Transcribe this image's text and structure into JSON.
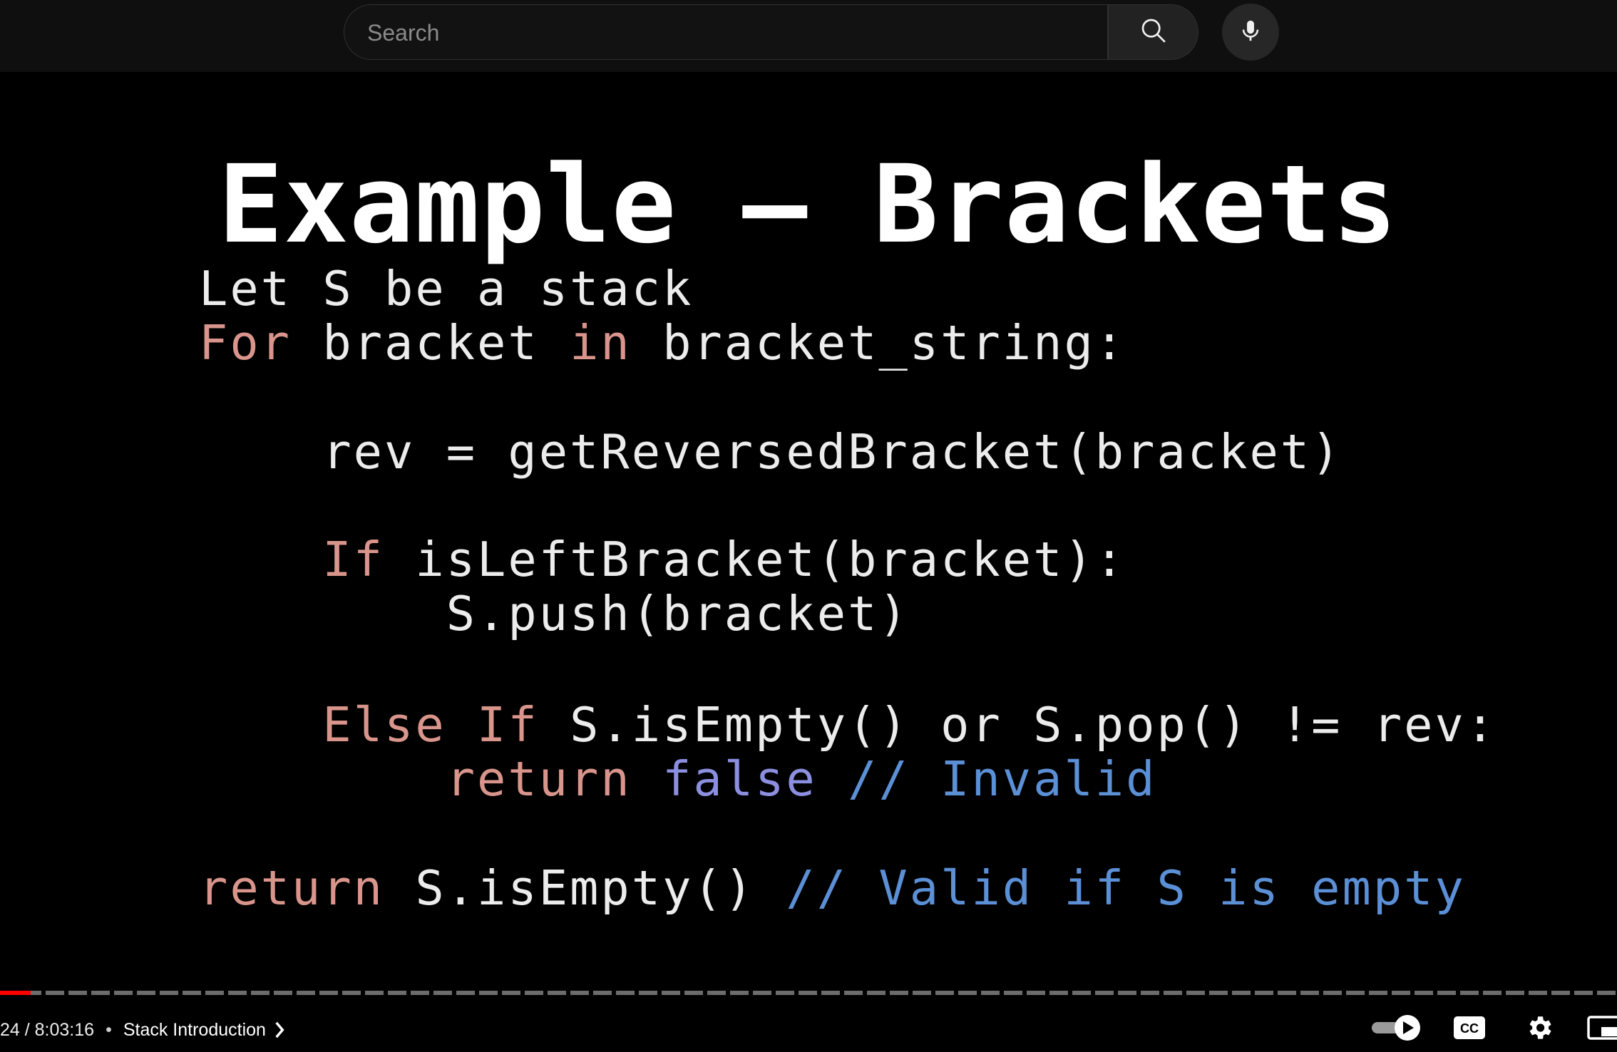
{
  "search": {
    "placeholder": "Search",
    "value": ""
  },
  "icons": {
    "search": "search-icon",
    "mic": "microphone-icon",
    "autoplay": "autoplay-toggle-icon",
    "captions": "closed-captions-icon",
    "settings": "gear-icon",
    "miniplayer": "miniplayer-icon",
    "chapter_next": "chevron-right-icon"
  },
  "slide": {
    "title": "Example – Brackets",
    "code_lines": [
      {
        "segments": [
          {
            "t": "Let S be a stack",
            "c": "txt"
          }
        ]
      },
      {
        "segments": [
          {
            "t": "For",
            "c": "kw"
          },
          {
            "t": " bracket ",
            "c": "txt"
          },
          {
            "t": "in",
            "c": "kw"
          },
          {
            "t": " bracket_string:",
            "c": "txt"
          }
        ]
      },
      {
        "segments": [
          {
            "t": "    rev = getReversedBracket(bracket)",
            "c": "txt"
          }
        ]
      },
      {
        "segments": [
          {
            "t": "    ",
            "c": "txt"
          },
          {
            "t": "If",
            "c": "kw"
          },
          {
            "t": " isLeftBracket(bracket):",
            "c": "txt"
          }
        ]
      },
      {
        "segments": [
          {
            "t": "        S.push(bracket)",
            "c": "txt"
          }
        ]
      },
      {
        "segments": [
          {
            "t": "    ",
            "c": "txt"
          },
          {
            "t": "Else If",
            "c": "kw"
          },
          {
            "t": " S.isEmpty() or S.pop() != rev:",
            "c": "txt"
          }
        ]
      },
      {
        "segments": [
          {
            "t": "        ",
            "c": "txt"
          },
          {
            "t": "return",
            "c": "kw"
          },
          {
            "t": " ",
            "c": "txt"
          },
          {
            "t": "false",
            "c": "bl"
          },
          {
            "t": " // Invalid",
            "c": "cm"
          }
        ]
      },
      {
        "segments": [
          {
            "t": "return",
            "c": "kw"
          },
          {
            "t": " S.isEmpty() ",
            "c": "txt"
          },
          {
            "t": "// Valid if S is empty",
            "c": "cm"
          }
        ]
      }
    ]
  },
  "player": {
    "time_display": "24 / 8:03:16",
    "separator": "•",
    "chapter_title": "Stack Introduction",
    "progress_fraction": 0.019,
    "autoplay_on": true
  },
  "colors": {
    "keyword": "#d9958b",
    "comment": "#5b8fd6",
    "literal": "#8c8fe0",
    "progress": "#ff0000"
  }
}
